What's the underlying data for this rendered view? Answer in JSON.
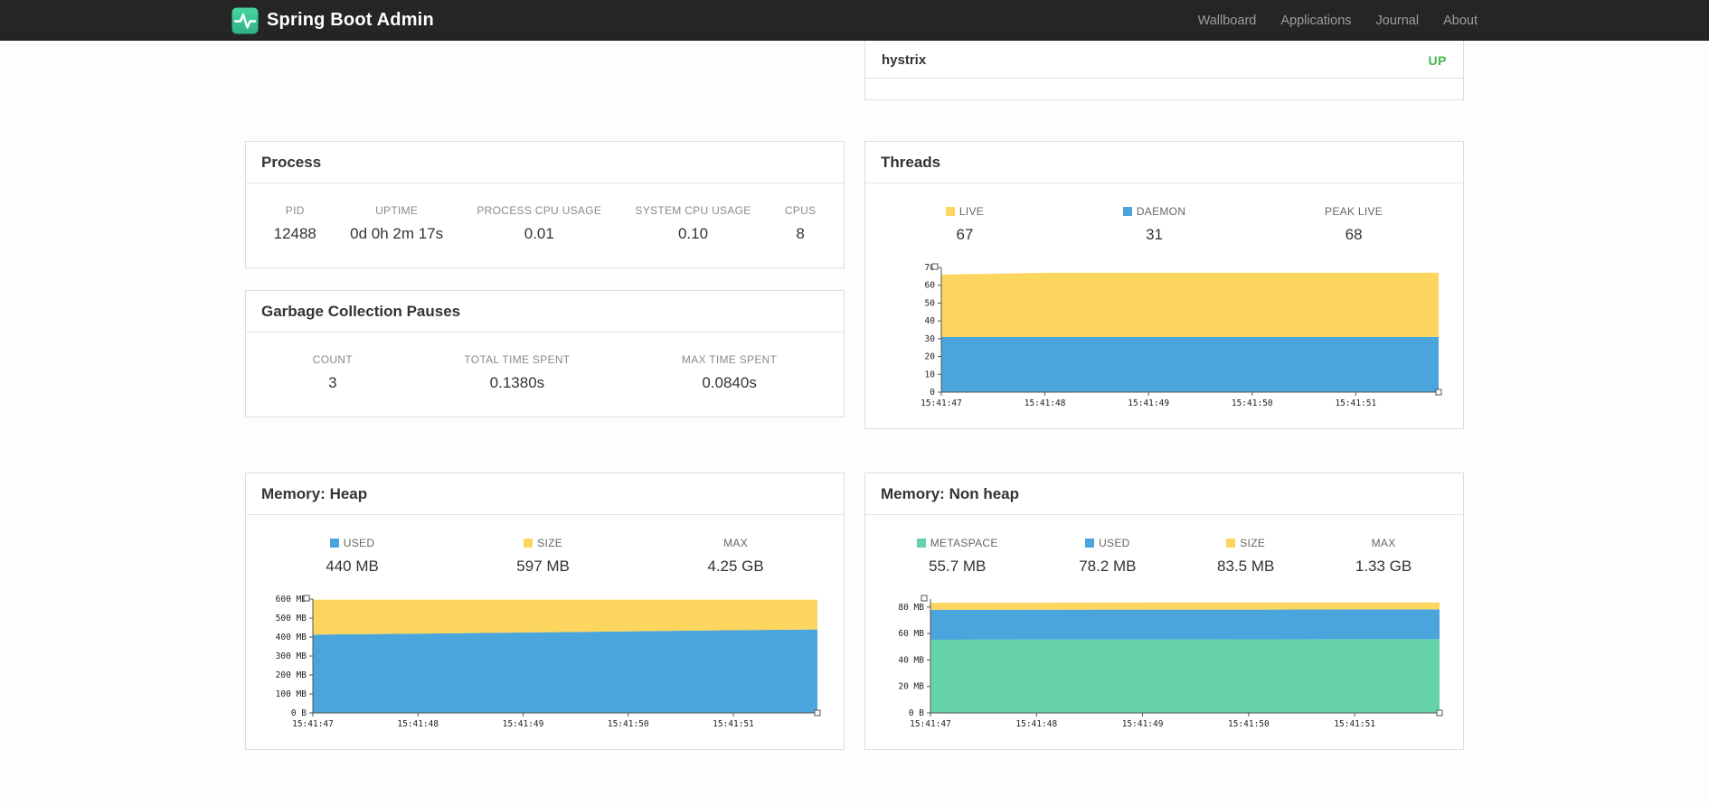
{
  "navbar": {
    "brand": "Spring Boot Admin",
    "links": [
      "Wallboard",
      "Applications",
      "Journal",
      "About"
    ]
  },
  "colors": {
    "status_up": "#42b84a",
    "yellow": "#FCD65F",
    "blue": "#4AA5DC",
    "green": "#66D2A9"
  },
  "applications": {
    "rows": [
      {
        "name": "hystrix",
        "status": "UP"
      }
    ]
  },
  "cards": {
    "process": {
      "title": "Process",
      "stats": [
        {
          "label": "PID",
          "value": "12488"
        },
        {
          "label": "UPTIME",
          "value": "0d 0h 2m 17s"
        },
        {
          "label": "PROCESS CPU USAGE",
          "value": "0.01"
        },
        {
          "label": "SYSTEM CPU USAGE",
          "value": "0.10"
        },
        {
          "label": "CPUS",
          "value": "8"
        }
      ]
    },
    "gc": {
      "title": "Garbage Collection Pauses",
      "stats": [
        {
          "label": "COUNT",
          "value": "3"
        },
        {
          "label": "TOTAL TIME SPENT",
          "value": "0.1380s"
        },
        {
          "label": "MAX TIME SPENT",
          "value": "0.0840s"
        }
      ]
    },
    "threads": {
      "title": "Threads",
      "legend": [
        {
          "label": "LIVE",
          "value": "67",
          "color": "#FCD65F"
        },
        {
          "label": "DAEMON",
          "value": "31",
          "color": "#4AA5DC"
        },
        {
          "label": "PEAK LIVE",
          "value": "68"
        }
      ],
      "chart": {
        "type": "area",
        "stacked": true,
        "ymax": 70,
        "y_ticks": [
          [
            0,
            "0"
          ],
          [
            10,
            "10"
          ],
          [
            20,
            "20"
          ],
          [
            30,
            "30"
          ],
          [
            40,
            "40"
          ],
          [
            50,
            "50"
          ],
          [
            60,
            "60"
          ],
          [
            70,
            "70"
          ]
        ],
        "x": [
          0,
          1,
          2,
          3,
          4,
          4.8
        ],
        "x_ticks": [
          [
            0,
            "15:41:47"
          ],
          [
            1,
            "15:41:48"
          ],
          [
            2,
            "15:41:49"
          ],
          [
            3,
            "15:41:50"
          ],
          [
            4,
            "15:41:51"
          ]
        ],
        "series": [
          {
            "name": "DAEMON",
            "color": "#4AA5DC",
            "tops": [
              31,
              31,
              31,
              31,
              31,
              31
            ]
          },
          {
            "name": "LIVE",
            "color": "#FCD65F",
            "tops": [
              66,
              67,
              67,
              67,
              67,
              67
            ]
          }
        ]
      }
    },
    "memory_heap": {
      "title": "Memory: Heap",
      "legend": [
        {
          "label": "USED",
          "value": "440 MB",
          "color": "#4AA5DC"
        },
        {
          "label": "SIZE",
          "value": "597 MB",
          "color": "#FCD65F"
        },
        {
          "label": "MAX",
          "value": "4.25 GB"
        }
      ],
      "chart": {
        "type": "area",
        "stacked": true,
        "ymax": 600,
        "y_ticks": [
          [
            0,
            "0 B"
          ],
          [
            100,
            "100 MB"
          ],
          [
            200,
            "200 MB"
          ],
          [
            300,
            "300 MB"
          ],
          [
            400,
            "400 MB"
          ],
          [
            500,
            "500 MB"
          ],
          [
            600,
            "600 MB"
          ]
        ],
        "x": [
          0,
          1,
          2,
          3,
          4,
          4.8
        ],
        "x_ticks": [
          [
            0,
            "15:41:47"
          ],
          [
            1,
            "15:41:48"
          ],
          [
            2,
            "15:41:49"
          ],
          [
            3,
            "15:41:50"
          ],
          [
            4,
            "15:41:51"
          ]
        ],
        "series": [
          {
            "name": "USED",
            "color": "#4AA5DC",
            "tops": [
              413,
              418,
              424,
              430,
              436,
              440
            ]
          },
          {
            "name": "SIZE",
            "color": "#FCD65F",
            "tops": [
              597,
              597,
              597,
              597,
              597,
              597
            ]
          }
        ]
      }
    },
    "memory_nonheap": {
      "title": "Memory: Non heap",
      "legend": [
        {
          "label": "METASPACE",
          "value": "55.7 MB",
          "color": "#66D2A9"
        },
        {
          "label": "USED",
          "value": "78.2 MB",
          "color": "#4AA5DC"
        },
        {
          "label": "SIZE",
          "value": "83.5 MB",
          "color": "#FCD65F"
        },
        {
          "label": "MAX",
          "value": "1.33 GB"
        }
      ],
      "chart": {
        "type": "area",
        "stacked": true,
        "ymax": 86,
        "y_ticks": [
          [
            0,
            "0 B"
          ],
          [
            20,
            "20 MB"
          ],
          [
            40,
            "40 MB"
          ],
          [
            60,
            "60 MB"
          ],
          [
            80,
            "80 MB"
          ]
        ],
        "x": [
          0,
          1,
          2,
          3,
          4,
          4.8
        ],
        "x_ticks": [
          [
            0,
            "15:41:47"
          ],
          [
            1,
            "15:41:48"
          ],
          [
            2,
            "15:41:49"
          ],
          [
            3,
            "15:41:50"
          ],
          [
            4,
            "15:41:51"
          ]
        ],
        "series": [
          {
            "name": "METASPACE",
            "color": "#66D2A9",
            "tops": [
              55.3,
              55.4,
              55.5,
              55.6,
              55.7,
              55.7
            ]
          },
          {
            "name": "USED",
            "color": "#4AA5DC",
            "tops": [
              77.9,
              78.0,
              78.1,
              78.1,
              78.2,
              78.2
            ]
          },
          {
            "name": "SIZE",
            "color": "#FCD65F",
            "tops": [
              83.2,
              83.3,
              83.4,
              83.5,
              83.5,
              83.5
            ]
          }
        ]
      }
    }
  }
}
